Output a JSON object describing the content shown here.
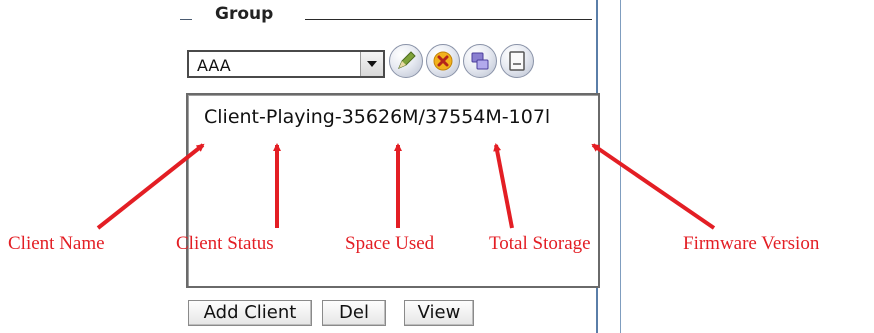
{
  "group": {
    "title": "Group",
    "selected_group": "AAA"
  },
  "toolbar_icons": [
    "edit-icon",
    "delete-icon",
    "clients-icon",
    "notes-icon"
  ],
  "client_list": {
    "items": [
      "Client-Playing-35626M/37554M-107l"
    ]
  },
  "buttons": {
    "add_client": "Add Client",
    "del": "Del",
    "view": "View"
  },
  "annotations": {
    "client_name": "Client Name",
    "client_status": "Client Status",
    "space_used": "Space Used",
    "total_storage": "Total Storage",
    "firmware_version": "Firmware Version"
  },
  "colors": {
    "annotation": "#e31e24",
    "panel_border": "#5a7ea8"
  }
}
